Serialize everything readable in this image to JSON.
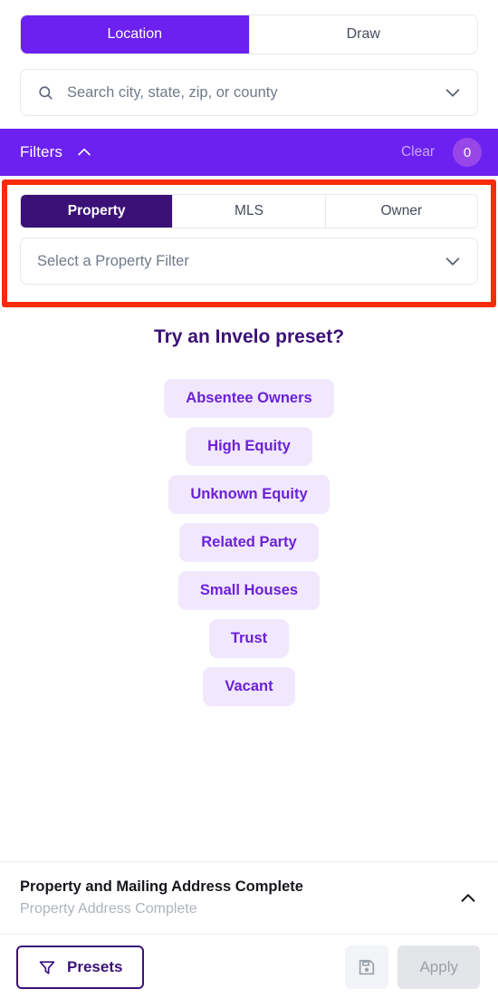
{
  "mode_tabs": [
    {
      "label": "Location",
      "active": true
    },
    {
      "label": "Draw",
      "active": false
    }
  ],
  "search": {
    "placeholder": "Search city, state, zip, or county",
    "value": "",
    "search_icon": "search-icon",
    "chevron_icon": "chevron-down-icon"
  },
  "filters_bar": {
    "title": "Filters",
    "caret_icon": "chevron-up-icon",
    "clear_label": "Clear",
    "count": "0"
  },
  "filter_type": {
    "tabs": [
      {
        "label": "Property",
        "active": true
      },
      {
        "label": "MLS",
        "active": false
      },
      {
        "label": "Owner",
        "active": false
      }
    ],
    "select_placeholder": "Select a Property Filter",
    "select_chevron_icon": "chevron-down-icon",
    "highlight_color": "#FA2B0A"
  },
  "presets": {
    "heading": "Try an Invelo preset?",
    "items": [
      "Absentee Owners",
      "High Equity",
      "Unknown Equity",
      "Related Party",
      "Small Houses",
      "Trust",
      "Vacant"
    ]
  },
  "address_section": {
    "title": "Property and Mailing Address Complete",
    "subtitle": "Property Address Complete",
    "caret_icon": "chevron-up-icon"
  },
  "footer": {
    "presets_label": "Presets",
    "presets_icon": "funnel-icon",
    "save_icon": "save-floppy-icon",
    "apply_label": "Apply"
  },
  "colors": {
    "brand_purple": "#6C21F0",
    "deep_purple": "#3B1178",
    "pill_bg": "#F1E8FE",
    "pill_text": "#6B21D8",
    "badge_bg": "#9747E8",
    "highlight_red": "#FA2B0A"
  }
}
